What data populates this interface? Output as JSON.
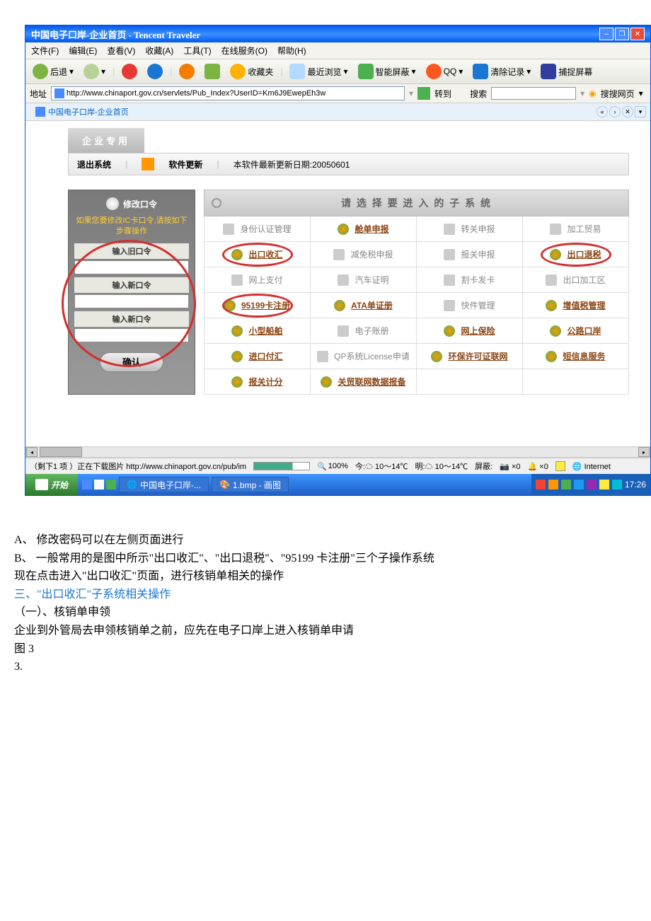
{
  "titlebar": {
    "title": "中国电子口岸-企业首页 - Tencent Traveler"
  },
  "menus": [
    "文件(F)",
    "编辑(E)",
    "查看(V)",
    "收藏(A)",
    "工具(T)",
    "在线服务(O)",
    "帮助(H)"
  ],
  "toolbar": {
    "back": "后退",
    "fav": "收藏夹",
    "recent": "最近浏览",
    "shield": "智能屏蔽",
    "qq": "QQ",
    "clear": "清除记录",
    "capture": "捕捉屏幕"
  },
  "addr": {
    "label": "地址",
    "url": "http://www.chinaport.gov.cn/servlets/Pub_Index?UserID=Km6J9EwepEh3w",
    "go": "转到",
    "search": "搜索",
    "search_page": "搜搜网页"
  },
  "tab": {
    "label": "中国电子口岸-企业首页"
  },
  "page": {
    "section_tab": "企业专用",
    "exit": "退出系统",
    "update": "软件更新",
    "upd_date": "本软件最新更新日期:20050601"
  },
  "sidebar": {
    "title": "修改口令",
    "msg": "如果您要修改IC卡口令,请按如下步骤操作",
    "l1": "输入旧口令",
    "l2": "输入新口令",
    "l3": "输入新口令",
    "btn": "确认"
  },
  "grid_header": "请 选 择 要 进 入 的 子 系 统",
  "grid": [
    [
      {
        "t": "身份认证管理",
        "a": false
      },
      {
        "t": "舱单申报",
        "a": true
      },
      {
        "t": "转关申报",
        "a": false
      },
      {
        "t": "加工贸易",
        "a": false
      }
    ],
    [
      {
        "t": "出口收汇",
        "a": true,
        "c": true
      },
      {
        "t": "减免税申报",
        "a": false
      },
      {
        "t": "报关申报",
        "a": false
      },
      {
        "t": "出口退税",
        "a": true,
        "c": true
      }
    ],
    [
      {
        "t": "网上支付",
        "a": false
      },
      {
        "t": "汽车证明",
        "a": false
      },
      {
        "t": "割卡发卡",
        "a": false
      },
      {
        "t": "出口加工区",
        "a": false
      }
    ],
    [
      {
        "t": "95199卡注册",
        "a": true,
        "c": true
      },
      {
        "t": "ATA单证册",
        "a": true
      },
      {
        "t": "快件管理",
        "a": false
      },
      {
        "t": "增值税管理",
        "a": true
      }
    ],
    [
      {
        "t": "小型船舶",
        "a": true
      },
      {
        "t": "电子账册",
        "a": false
      },
      {
        "t": "网上保险",
        "a": true
      },
      {
        "t": "公路口岸",
        "a": true
      }
    ],
    [
      {
        "t": "进口付汇",
        "a": true
      },
      {
        "t": "QP系统License申请",
        "a": false
      },
      {
        "t": "环保许可证联网",
        "a": true
      },
      {
        "t": "短信息服务",
        "a": true
      }
    ],
    [
      {
        "t": "报关计分",
        "a": true
      },
      {
        "t": "关贸联网数据报备",
        "a": true
      }
    ]
  ],
  "status": {
    "load": "（剩下1 项 ）正在下载图片 http://www.chinaport.gov.cn/pub/im",
    "zoom": "100%",
    "today_l": "今:",
    "today": "10～14℃",
    "tom_l": "明:",
    "tom": "10～14℃",
    "block_l": "屏蔽:",
    "x0a": "×0",
    "x0b": "×0",
    "zone": "Internet"
  },
  "taskbar": {
    "start": "开始",
    "t1": "中国电子口岸-...",
    "t2": "1.bmp - 画图",
    "clock": "17:26"
  },
  "doc": {
    "l1": "A、 修改密码可以在左侧页面进行",
    "l2": "B、 一般常用的是图中所示\"出口收汇\"、\"出口退税\"、\"95199 卡注册\"三个子操作系统",
    "l3": "现在点击进入\"出口收汇\"页面，进行核销单相关的操作",
    "l4": "三、\"出口收汇\"子系统相关操作",
    "l5": "（一）、核销单申领",
    "l6": "企业到外管局去申领核销单之前，应先在电子口岸上进入核销单申请",
    "l7": "图 3",
    "l8": "3."
  }
}
